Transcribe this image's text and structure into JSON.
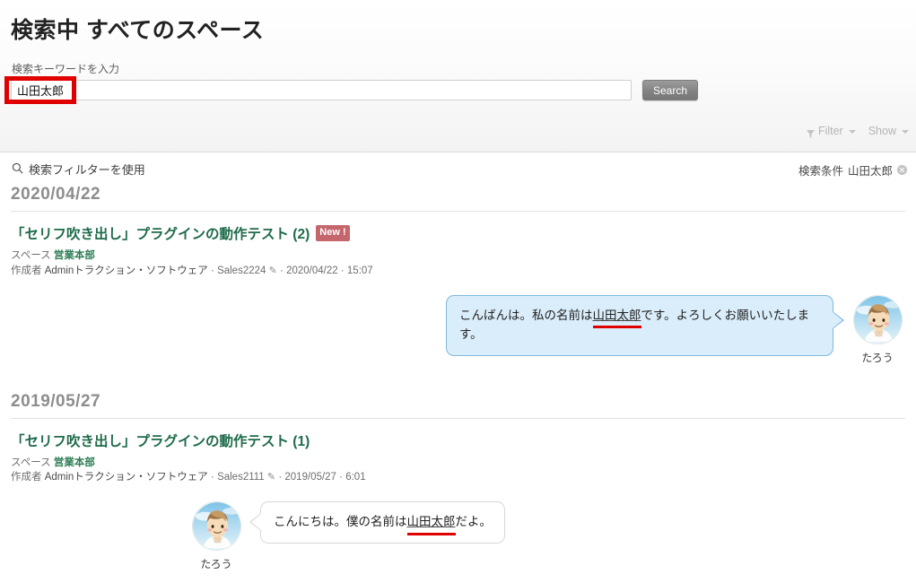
{
  "header": {
    "page_title": "検索中 すべてのスペース",
    "search_label": "検索キーワードを入力",
    "search_value": "山田太郎",
    "search_placeholder": "",
    "search_button": "Search",
    "filter_label": "Filter",
    "show_label": "Show",
    "filter_icon": "funnel-icon",
    "caret_icon": "chevron-down-icon"
  },
  "filter_bar": {
    "use_filter_label": "検索フィルターを使用",
    "search_icon": "search-icon",
    "condition_label": "検索条件",
    "condition_value": "山田太郎",
    "remove_icon": "close-circle-icon"
  },
  "results": [
    {
      "date": "2020/04/22",
      "title": "「セリフ吹き出し」プラグインの動作テスト (2)",
      "badge": "New !",
      "space_label": "スペース",
      "space_name": "営業本部",
      "author_label": "作成者",
      "author_name": "Adminトラクション・ソフトウェア",
      "separator": "·",
      "id": "Sales2224",
      "pencil_icon": "pencil-icon",
      "date_meta": "2020/04/22",
      "time_meta": "15:07",
      "bubble": {
        "side": "right",
        "style": "blue",
        "text_before": "こんばんは。私の名前は",
        "text_hit": "山田太郎",
        "text_after": "です。よろしくお願いいたします。"
      },
      "avatar": {
        "name": "たろう",
        "icon": "user-avatar"
      }
    },
    {
      "date": "2019/05/27",
      "title": "「セリフ吹き出し」プラグインの動作テスト (1)",
      "badge": "",
      "space_label": "スペース",
      "space_name": "営業本部",
      "author_label": "作成者",
      "author_name": "Adminトラクション・ソフトウェア",
      "separator": "·",
      "id": "Sales2111",
      "pencil_icon": "pencil-icon",
      "date_meta": "2019/05/27",
      "time_meta": "6:01",
      "bubble": {
        "side": "left",
        "style": "gray",
        "text_before": "こんにちは。僕の名前は",
        "text_hit": "山田太郎",
        "text_after": "だよ。"
      },
      "avatar": {
        "name": "たろう",
        "icon": "user-avatar"
      }
    }
  ],
  "colors": {
    "title_green": "#1f6b4a",
    "badge_red": "#c4666c",
    "annotation_red": "#e00000",
    "bubble_blue_fill": "#daedfa",
    "bubble_blue_border": "#7fb9dd",
    "bubble_gray_border": "#d8d8d8"
  }
}
